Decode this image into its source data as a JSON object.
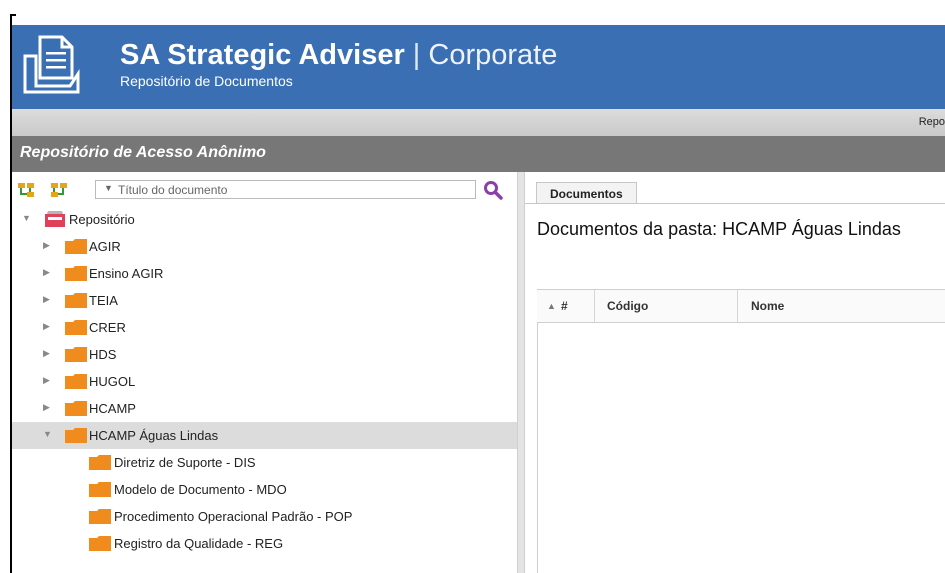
{
  "header": {
    "title_main": "SA Strategic Adviser",
    "title_separator": " | ",
    "title_sub": "Corporate",
    "subtitle": "Repositório de Documentos",
    "logo_icon": "document-folder-icon"
  },
  "toolbar": {
    "text": "Repo"
  },
  "section": {
    "title": "Repositório de Acesso Anônimo"
  },
  "tree_panel": {
    "tool_icons": [
      "expand-tree-icon",
      "collapse-tree-icon"
    ],
    "search_placeholder": "Título do documento",
    "search_value": "",
    "items": [
      {
        "label": "Repositório",
        "level": 0,
        "state": "expanded",
        "icon": "repository-icon"
      },
      {
        "label": "AGIR",
        "level": 1,
        "state": "collapsed",
        "icon": "folder-icon"
      },
      {
        "label": "Ensino AGIR",
        "level": 1,
        "state": "collapsed",
        "icon": "folder-icon"
      },
      {
        "label": "TEIA",
        "level": 1,
        "state": "collapsed",
        "icon": "folder-icon"
      },
      {
        "label": "CRER",
        "level": 1,
        "state": "collapsed",
        "icon": "folder-icon"
      },
      {
        "label": "HDS",
        "level": 1,
        "state": "collapsed",
        "icon": "folder-icon"
      },
      {
        "label": "HUGOL",
        "level": 1,
        "state": "collapsed",
        "icon": "folder-icon"
      },
      {
        "label": "HCAMP",
        "level": 1,
        "state": "collapsed",
        "icon": "folder-icon"
      },
      {
        "label": "HCAMP Águas Lindas",
        "level": 1,
        "state": "expanded",
        "icon": "folder-icon",
        "selected": true
      },
      {
        "label": "Diretriz de Suporte - DIS",
        "level": 2,
        "state": "leaf",
        "icon": "folder-icon"
      },
      {
        "label": "Modelo de Documento - MDO",
        "level": 2,
        "state": "leaf",
        "icon": "folder-icon"
      },
      {
        "label": "Procedimento Operacional Padrão - POP",
        "level": 2,
        "state": "leaf",
        "icon": "folder-icon"
      },
      {
        "label": "Registro da Qualidade - REG",
        "level": 2,
        "state": "leaf",
        "icon": "folder-icon"
      }
    ]
  },
  "documents_panel": {
    "tab_label": "Documentos",
    "heading": "Documentos da pasta: HCAMP Águas Lindas",
    "columns": [
      "#",
      "Código",
      "Nome"
    ],
    "rows": []
  },
  "colors": {
    "header_bg": "#3a6fb4",
    "section_bg": "#777777",
    "folder": "#f08c1e",
    "repository_icon": "#e0405a",
    "search_icon": "#8b3fa8",
    "tree_tool_icon": "#e5a51a",
    "selected_row": "#dcdcdc"
  }
}
